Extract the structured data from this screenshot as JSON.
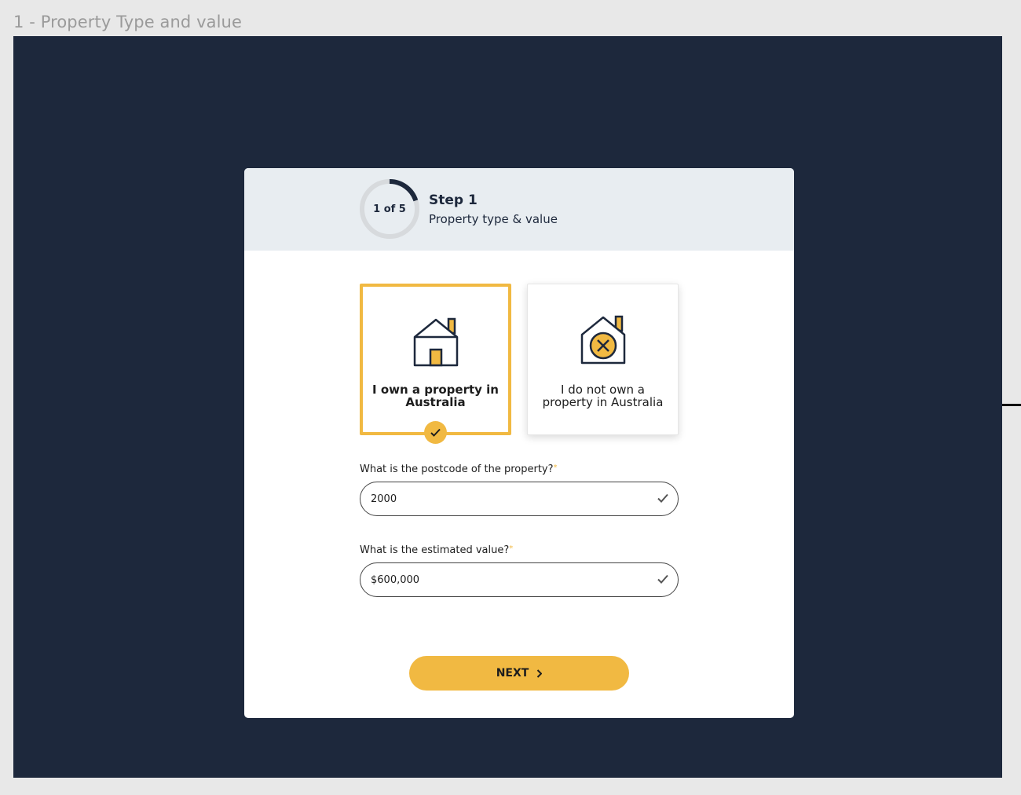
{
  "frame": {
    "label": "1 - Property Type and value"
  },
  "colors": {
    "accent": "#f1b942",
    "navy": "#1d283c",
    "header_bg": "#e8edf1"
  },
  "progress": {
    "text": "1 of 5",
    "current": 1,
    "total": 5
  },
  "step": {
    "title": "Step 1",
    "subtitle": "Property type & value"
  },
  "options": [
    {
      "label": "I own a property in Australia",
      "icon": "house-icon",
      "selected": true
    },
    {
      "label": "I do not own a property in Australia",
      "icon": "house-cross-icon",
      "selected": false
    }
  ],
  "fields": {
    "postcode": {
      "label": "What is the postcode of the property?",
      "required_mark": "*",
      "value": "2000"
    },
    "value": {
      "label": "What is the estimated value?",
      "required_mark": "*",
      "value": "$600,000"
    }
  },
  "actions": {
    "next_label": "NEXT"
  }
}
